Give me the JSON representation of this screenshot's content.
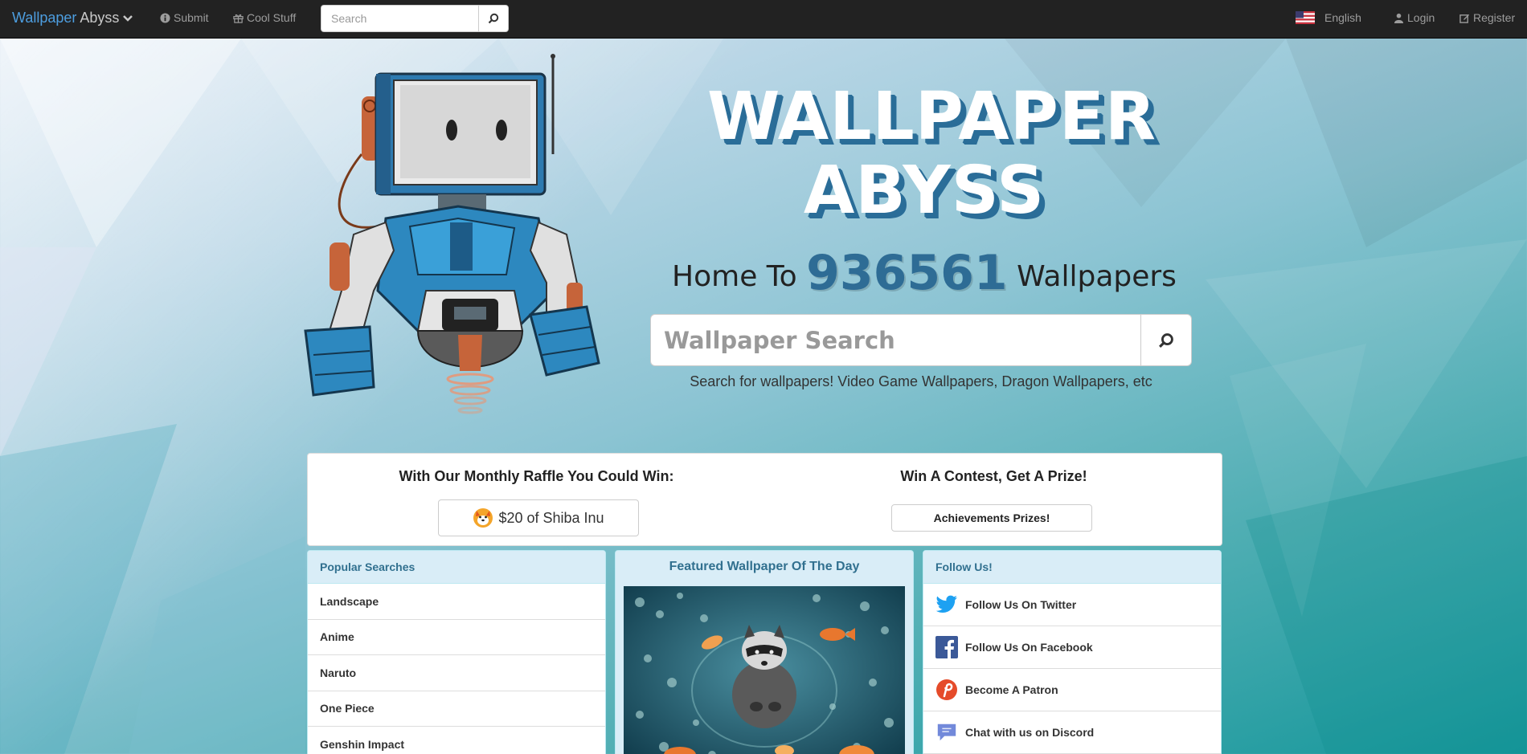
{
  "navbar": {
    "brand_part1": "Wallpaper",
    "brand_part2": "Abyss",
    "submit_label": "Submit",
    "cool_stuff_label": "Cool Stuff",
    "search_placeholder": "Search",
    "language_label": "English",
    "login_label": "Login",
    "register_label": "Register"
  },
  "hero": {
    "title_line1": "WALLPAPER",
    "title_line2": "ABYSS",
    "home_to": "Home To",
    "wallpaper_count": "936561",
    "wallpapers_word": "Wallpapers",
    "search_placeholder": "Wallpaper Search",
    "search_hint": "Search for wallpapers! Video Game Wallpapers, Dragon Wallpapers, etc"
  },
  "raffle": {
    "raffle_heading": "With Our Monthly Raffle You Could Win:",
    "raffle_button": "$20 of Shiba Inu",
    "contest_heading": "Win A Contest, Get A Prize!",
    "contest_button": "Achievements Prizes!"
  },
  "popular": {
    "heading": "Popular Searches",
    "items": [
      "Landscape",
      "Anime",
      "Naruto",
      "One Piece",
      "Genshin Impact"
    ]
  },
  "featured": {
    "heading": "Featured Wallpaper Of The Day"
  },
  "follow": {
    "heading": "Follow Us!",
    "items": [
      {
        "label": "Follow Us On Twitter",
        "icon": "twitter-icon"
      },
      {
        "label": "Follow Us On Facebook",
        "icon": "facebook-icon"
      },
      {
        "label": "Become A Patron",
        "icon": "patreon-icon"
      },
      {
        "label": "Chat with us on Discord",
        "icon": "discord-icon"
      }
    ]
  },
  "colors": {
    "navbar_bg": "#222222",
    "brand_accent": "#4d9ee0",
    "title_shadow": "#2a6d98",
    "panel_heading_bg": "#d9edf7",
    "panel_heading_text": "#31708f"
  }
}
